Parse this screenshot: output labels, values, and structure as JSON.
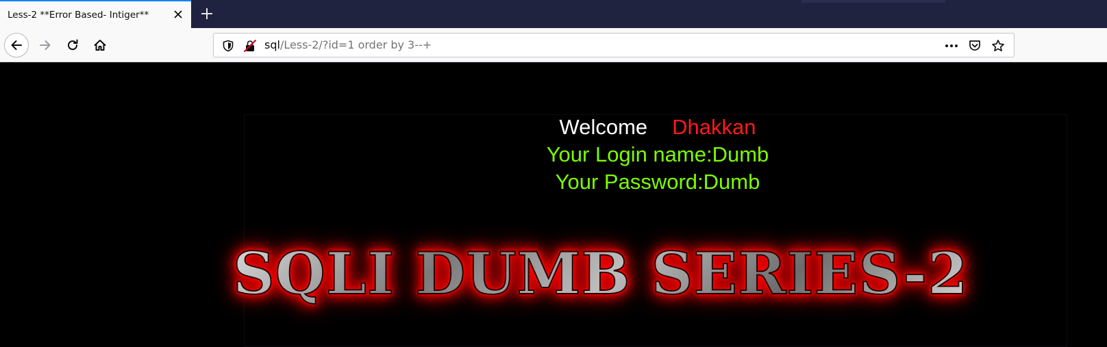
{
  "browser": {
    "tab": {
      "title": "Less-2 **Error Based- Intiger**"
    },
    "address": {
      "host": "sql",
      "path": "/Less-2/?id=1 order by 3--+"
    },
    "accent_color": "#0a84ff"
  },
  "page": {
    "welcome_label": "Welcome",
    "user_name": "Dhakkan",
    "login_line": "Your Login name:Dumb",
    "password_line": "Your Password:Dumb",
    "banner_text": "SQLI DUMB SERIES-2",
    "colors": {
      "background": "#000000",
      "welcome": "#ffffff",
      "user_name": "#ff1a1a",
      "credentials": "#7cfc00",
      "banner_glow": "#ff0000"
    }
  },
  "icons": {
    "tab_close": "close-icon",
    "new_tab": "plus-icon",
    "back": "arrow-left-icon",
    "forward": "arrow-right-icon",
    "reload": "reload-icon",
    "home": "home-icon",
    "tracking": "shield-icon",
    "insecure": "insecure-lock-icon",
    "page_actions": "more-horizontal-icon",
    "pocket": "pocket-icon",
    "bookmark": "star-icon"
  }
}
